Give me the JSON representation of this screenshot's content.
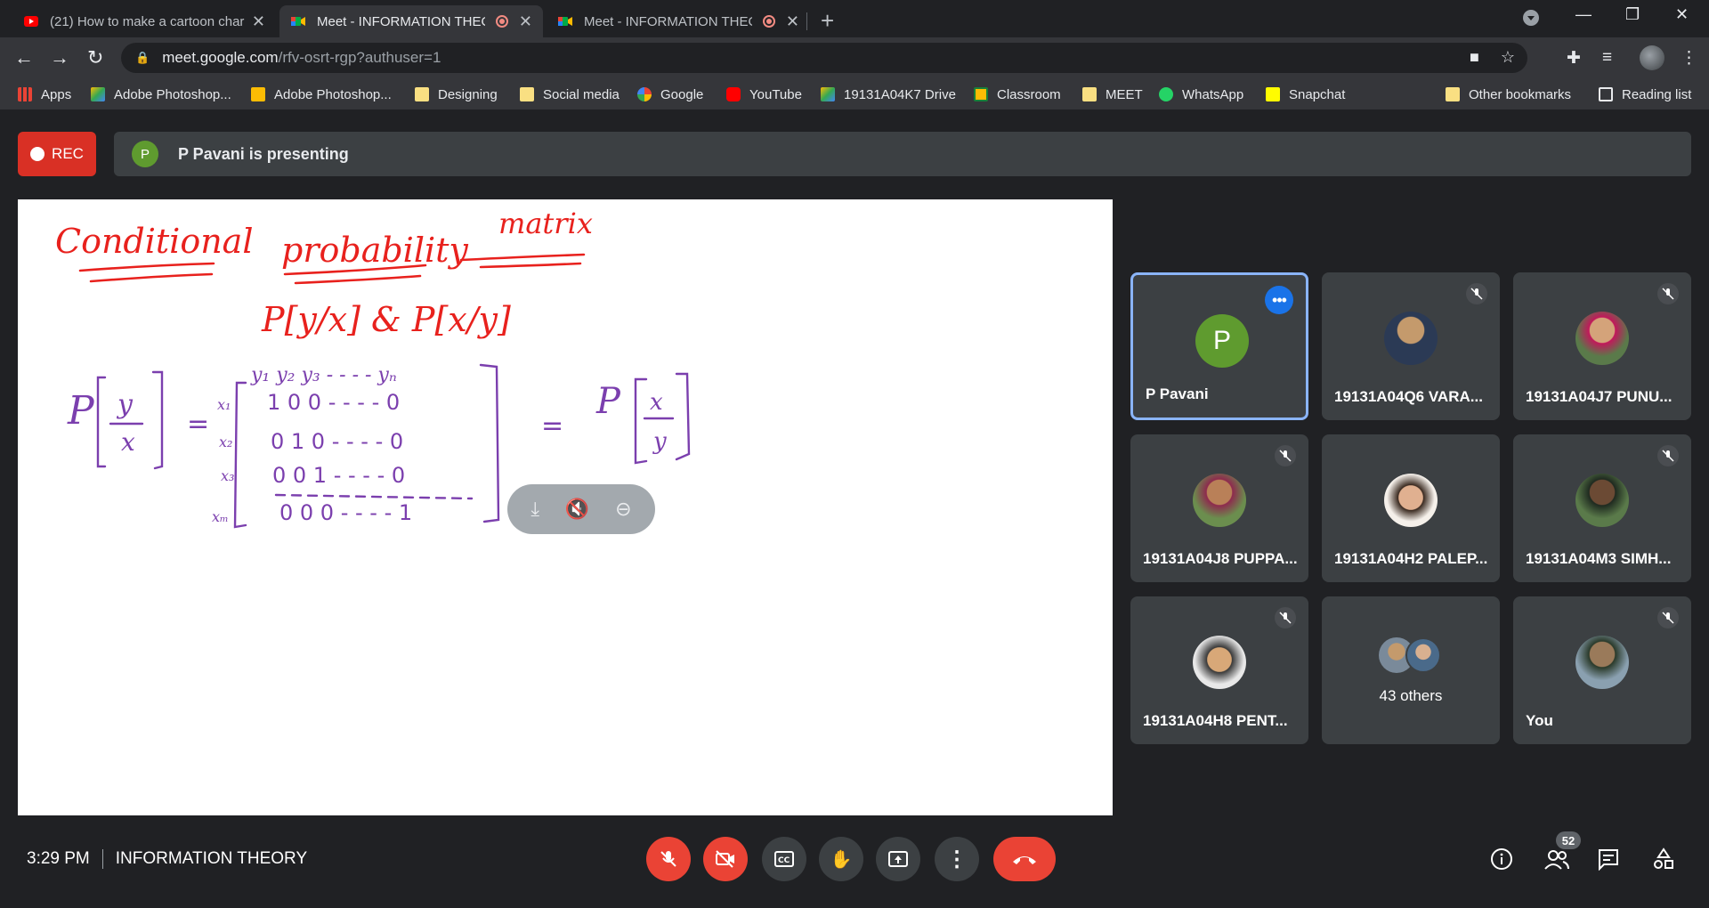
{
  "browser": {
    "tabs": [
      {
        "title": "(21) How to make a cartoon char",
        "favicon": "youtube-icon"
      },
      {
        "title": "Meet - INFORMATION THEO",
        "favicon": "meet-icon",
        "recording": true
      },
      {
        "title": "Meet - INFORMATION THEO",
        "favicon": "meet-icon",
        "recording": true
      }
    ],
    "url_host": "meet.google.com",
    "url_path": "/rfv-osrt-rgp?authuser=1",
    "bookmarks": [
      {
        "label": "Apps",
        "icon": "apps-grid-icon"
      },
      {
        "label": "Adobe Photoshop...",
        "icon": "drive-icon"
      },
      {
        "label": "Adobe Photoshop...",
        "icon": "bookmark-icon"
      },
      {
        "label": "Designing",
        "icon": "folder-icon"
      },
      {
        "label": "Social media",
        "icon": "folder-icon"
      },
      {
        "label": "Google",
        "icon": "google-icon"
      },
      {
        "label": "YouTube",
        "icon": "youtube-icon"
      },
      {
        "label": "19131A04K7 Drive",
        "icon": "drive-icon"
      },
      {
        "label": "Classroom",
        "icon": "classroom-icon"
      },
      {
        "label": "MEET",
        "icon": "folder-icon"
      },
      {
        "label": "WhatsApp",
        "icon": "whatsapp-icon"
      },
      {
        "label": "Snapchat",
        "icon": "snapchat-icon"
      },
      {
        "label": "Other bookmarks",
        "icon": "folder-icon"
      },
      {
        "label": "Reading list",
        "icon": "reading-list-icon"
      }
    ]
  },
  "meet": {
    "rec_label": "REC",
    "presenter_initial": "P",
    "presenting_text": "P Pavani is presenting",
    "whiteboard": {
      "title_words": [
        "Conditional",
        "probability",
        "matrix"
      ],
      "subtitle": "P[y/x] & P[x/y]"
    },
    "participants": [
      {
        "name": "P Pavani",
        "initial": "P",
        "selected": true
      },
      {
        "name": "19131A04Q6 VARA...",
        "muted": true
      },
      {
        "name": "19131A04J7 PUNU...",
        "muted": true
      },
      {
        "name": "19131A04J8 PUPPA...",
        "muted": true
      },
      {
        "name": "19131A04H2 PALEP...",
        "muted": true
      },
      {
        "name": "19131A04M3 SIMH...",
        "muted": true
      },
      {
        "name": "19131A04H8 PENT...",
        "muted": true
      },
      {
        "name": "43 others"
      },
      {
        "name": "You",
        "muted": true
      }
    ],
    "time": "3:29 PM",
    "meeting_title": "INFORMATION THEORY",
    "participant_count": "52"
  },
  "colors": {
    "accent": "#8ab4f8",
    "danger": "#ea4335",
    "ink_red": "#e8211d",
    "ink_purple": "#7b3fae"
  }
}
